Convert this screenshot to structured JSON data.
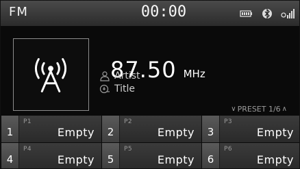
{
  "status": {
    "mode": "FM",
    "clock": "00:00",
    "icons": [
      "battery-icon",
      "bluetooth-icon",
      "signal-strength-icon"
    ]
  },
  "now_playing": {
    "frequency": "87.50",
    "unit": "MHz",
    "artist_label": "Artist",
    "title_label": "Title",
    "art_icon": "radio-antenna-icon"
  },
  "preset_nav": {
    "label": "PRESET 1/6",
    "down_icon": "chevron-down-icon",
    "up_icon": "chevron-up-icon"
  },
  "presets": [
    {
      "num": "1",
      "code": "P1",
      "label": "Empty"
    },
    {
      "num": "2",
      "code": "P2",
      "label": "Empty"
    },
    {
      "num": "3",
      "code": "P3",
      "label": "Empty"
    },
    {
      "num": "4",
      "code": "P4",
      "label": "Empty"
    },
    {
      "num": "5",
      "code": "P5",
      "label": "Empty"
    },
    {
      "num": "6",
      "code": "P6",
      "label": "Empty"
    }
  ]
}
